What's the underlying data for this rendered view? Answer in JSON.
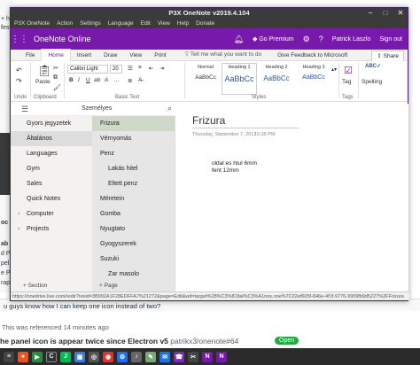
{
  "background": {
    "left_fragments": [
      "+ ha",
      "fest",
      "oc",
      "ab",
      "d P",
      "pel",
      "e P",
      "rap"
    ],
    "comment_text": "u guys know how I can keep one icon instead of two?",
    "reference_time": "This was referenced 14 minutes ago",
    "issue_title": "he panel icon is appear twice since Electron v5",
    "issue_repo": "patrikx3/onenote#64",
    "open_badge": "Open"
  },
  "window": {
    "title": "P3X OneNote v2019.4.104",
    "menu": [
      "P3X OneNote",
      "Action",
      "Settings",
      "Language",
      "Edit",
      "View",
      "Help",
      "Donate"
    ]
  },
  "appbar": {
    "app_name": "OneNote Online",
    "go_premium": "Go Premium",
    "user": "Patrick Laszlo",
    "sign_out": "Sign out"
  },
  "ribbon_tabs": {
    "tabs": [
      "File",
      "Home",
      "Insert",
      "Draw",
      "View",
      "Print"
    ],
    "tell_me": "Tell me what you want to do",
    "feedback": "Give Feedback to Microsoft",
    "share": "Share"
  },
  "ribbon": {
    "font_name": "Calibri Light",
    "font_size": "20",
    "paste": "Paste",
    "undo": "Undo",
    "clipboard": "Clipboard",
    "basic_text": "Basic Text",
    "styles_label": "Styles",
    "tags_label": "Tags",
    "tag_btn": "Tag",
    "spelling_btn": "Spelling",
    "styles": [
      {
        "name": "Normal",
        "preview": "AaBbCc"
      },
      {
        "name": "Heading 1",
        "preview": "AaBbCc"
      },
      {
        "name": "Heading 2",
        "preview": "AaBbCc"
      },
      {
        "name": "Heading 3",
        "preview": "AaBbCc"
      }
    ]
  },
  "nav": {
    "notebook": "Személyes",
    "add_section": "+ Section",
    "add_page": "+ Page",
    "sections": [
      "Gyors jegyzetek",
      "Általános",
      "Languages",
      "Gym",
      "Sales",
      "Quick Notes",
      "Computer",
      "Projects"
    ],
    "pages": [
      "Frizura",
      "Vérnyomás",
      "Penz",
      "Lakás hitel",
      "Eltett penz",
      "Méretein",
      "Gomba",
      "Nyugtato",
      "Gyogyszerek",
      "Suzuki",
      "Zar masolo"
    ]
  },
  "page": {
    "title": "Frizura",
    "date": "Thursday, September 7, 2017",
    "time": "10:35 PM",
    "line1": "oldal es htul 6mm",
    "line2": "fent 12mm"
  },
  "status_url": "https://onedrive.live.com/redir?resid=3B992A1F28EDFFA7%21272&page=Edit&wd=target%28%C3%81ltal%C3%A1nos.one%7C02ef605f-846e-4f1f-9776-9909fb9d5227%2FFrizura"
}
